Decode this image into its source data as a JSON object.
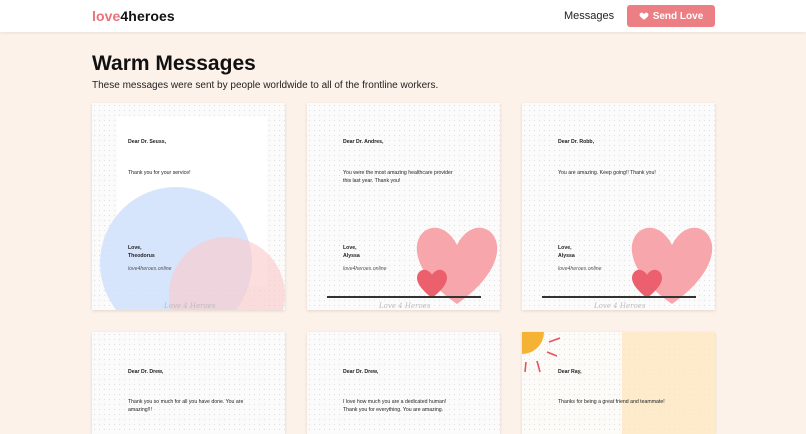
{
  "nav": {
    "logo_part1": "love",
    "logo_part2": "4heroes",
    "messages_link": "Messages",
    "send_button": "Send Love"
  },
  "header": {
    "title": "Warm Messages",
    "subtitle": "These messages were sent by people worldwide to all of the frontline workers."
  },
  "colors": {
    "accent": "#ec7f83",
    "page_bg": "#fdf2ea"
  },
  "cards": [
    {
      "greeting": "Dear Dr. Seuss,",
      "body": "Thank you for your service!",
      "signoff": "Love,",
      "sender": "Theodorus",
      "site": "love4heroes.online",
      "brand": "Love 4 Heroes",
      "theme": "circles"
    },
    {
      "greeting": "Dear Dr. Andres,",
      "body": "You were the most amazing healthcare provider this last year. Thank you!",
      "signoff": "Love,",
      "sender": "Alyssa",
      "site": "love4heroes.online",
      "brand": "Love 4 Heroes",
      "theme": "hearts"
    },
    {
      "greeting": "Dear Dr. Robb,",
      "body": "You are amazing. Keep going!! Thank you!",
      "signoff": "Love,",
      "sender": "Alyssa",
      "site": "love4heroes.online",
      "brand": "Love 4 Heroes",
      "theme": "hearts"
    },
    {
      "greeting": "Dear Dr. Drew,",
      "body": "Thank you so much for all you have done. You are amazing!!!",
      "theme": "plain"
    },
    {
      "greeting": "Dear Dr. Drew,",
      "body": "I love how much you are a dedicated human! Thank you for everything. You are amazing.",
      "theme": "plain"
    },
    {
      "greeting": "Dear Ray,",
      "body": "Thanks for being a great friend and teammate!",
      "theme": "sun"
    }
  ]
}
